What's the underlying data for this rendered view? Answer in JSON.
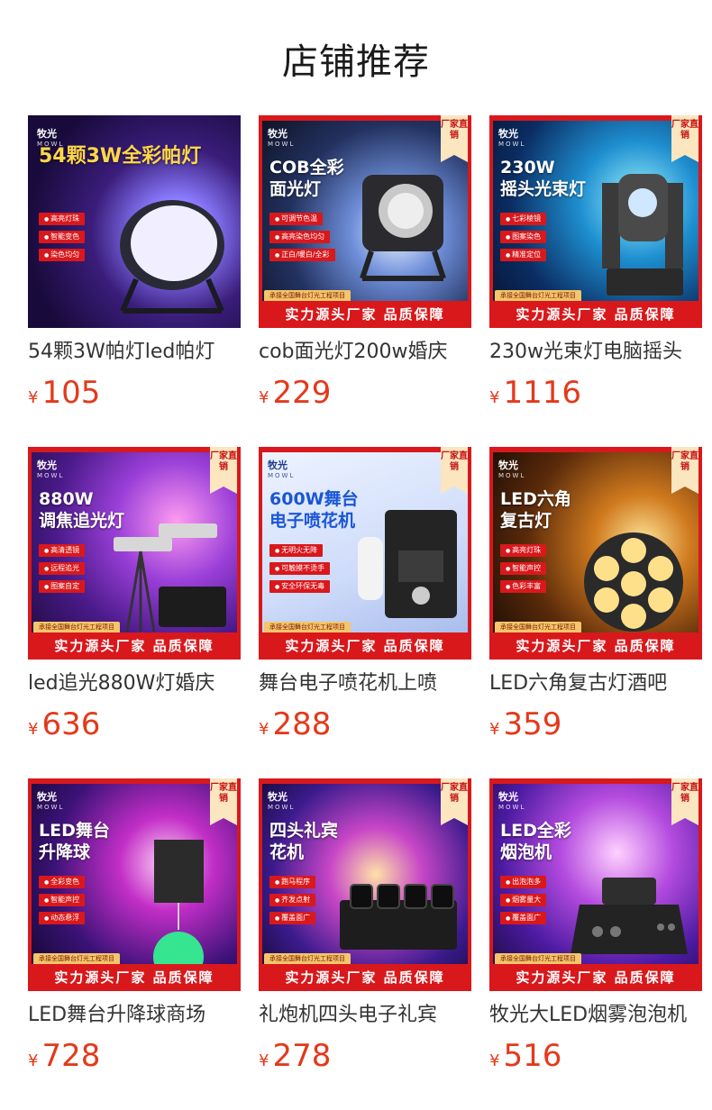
{
  "header": {
    "title": "店铺推荐"
  },
  "badge_text": "厂家直销",
  "bottom_bar_text": "实力源头厂家 品质保障",
  "sub_strip_text": "承接全国舞台灯光工程项目",
  "brand": {
    "name": "牧光",
    "latin": "MOWL"
  },
  "currency": "¥",
  "colors": {
    "price": "#e4391b",
    "frame_red": "#d9181c",
    "badge_bg": "#fbe6c0"
  },
  "products": [
    {
      "title": "54颗3W帕灯led帕灯",
      "price": "105",
      "headline": "54颗3W全彩帕灯",
      "features": [
        "高亮灯珠",
        "智能变色",
        "染色均匀"
      ],
      "has_badge": false
    },
    {
      "title": "cob面光灯200w婚庆",
      "price": "229",
      "headline": "COB全彩\n面光灯",
      "features": [
        "可调节色温",
        "高亮染色均匀",
        "正白/暖白/全彩"
      ],
      "has_badge": true
    },
    {
      "title": "230w光束灯电脑摇头",
      "price": "1116",
      "headline": "230W\n摇头光束灯",
      "features": [
        "七彩棱镜",
        "图案染色",
        "精准定位"
      ],
      "has_badge": true
    },
    {
      "title": "led追光880W灯婚庆",
      "price": "636",
      "headline": "880W\n调焦追光灯",
      "features": [
        "高清透镜",
        "远程追光",
        "图案自定"
      ],
      "has_badge": true
    },
    {
      "title": "舞台电子喷花机上喷",
      "price": "288",
      "headline": "600W舞台\n电子喷花机",
      "features": [
        "无明火无降",
        "可触摸不烫手",
        "安全环保无毒"
      ],
      "has_badge": true
    },
    {
      "title": "LED六角复古灯酒吧",
      "price": "359",
      "headline": "LED六角\n复古灯",
      "features": [
        "高亮灯珠",
        "智能声控",
        "色彩丰富"
      ],
      "has_badge": true
    },
    {
      "title": "LED舞台升降球商场",
      "price": "728",
      "headline": "LED舞台\n升降球",
      "features": [
        "全彩变色",
        "智能声控",
        "动态悬浮"
      ],
      "has_badge": true
    },
    {
      "title": "礼炮机四头电子礼宾",
      "price": "278",
      "headline": "四头礼宾\n花机",
      "features": [
        "跑马程序",
        "齐发点射",
        "覆盖面广"
      ],
      "has_badge": true
    },
    {
      "title": "牧光大LED烟雾泡泡机",
      "price": "516",
      "headline": "LED全彩\n烟泡机",
      "features": [
        "出泡泡多",
        "烟雾量大",
        "覆盖面广"
      ],
      "has_badge": true
    }
  ]
}
